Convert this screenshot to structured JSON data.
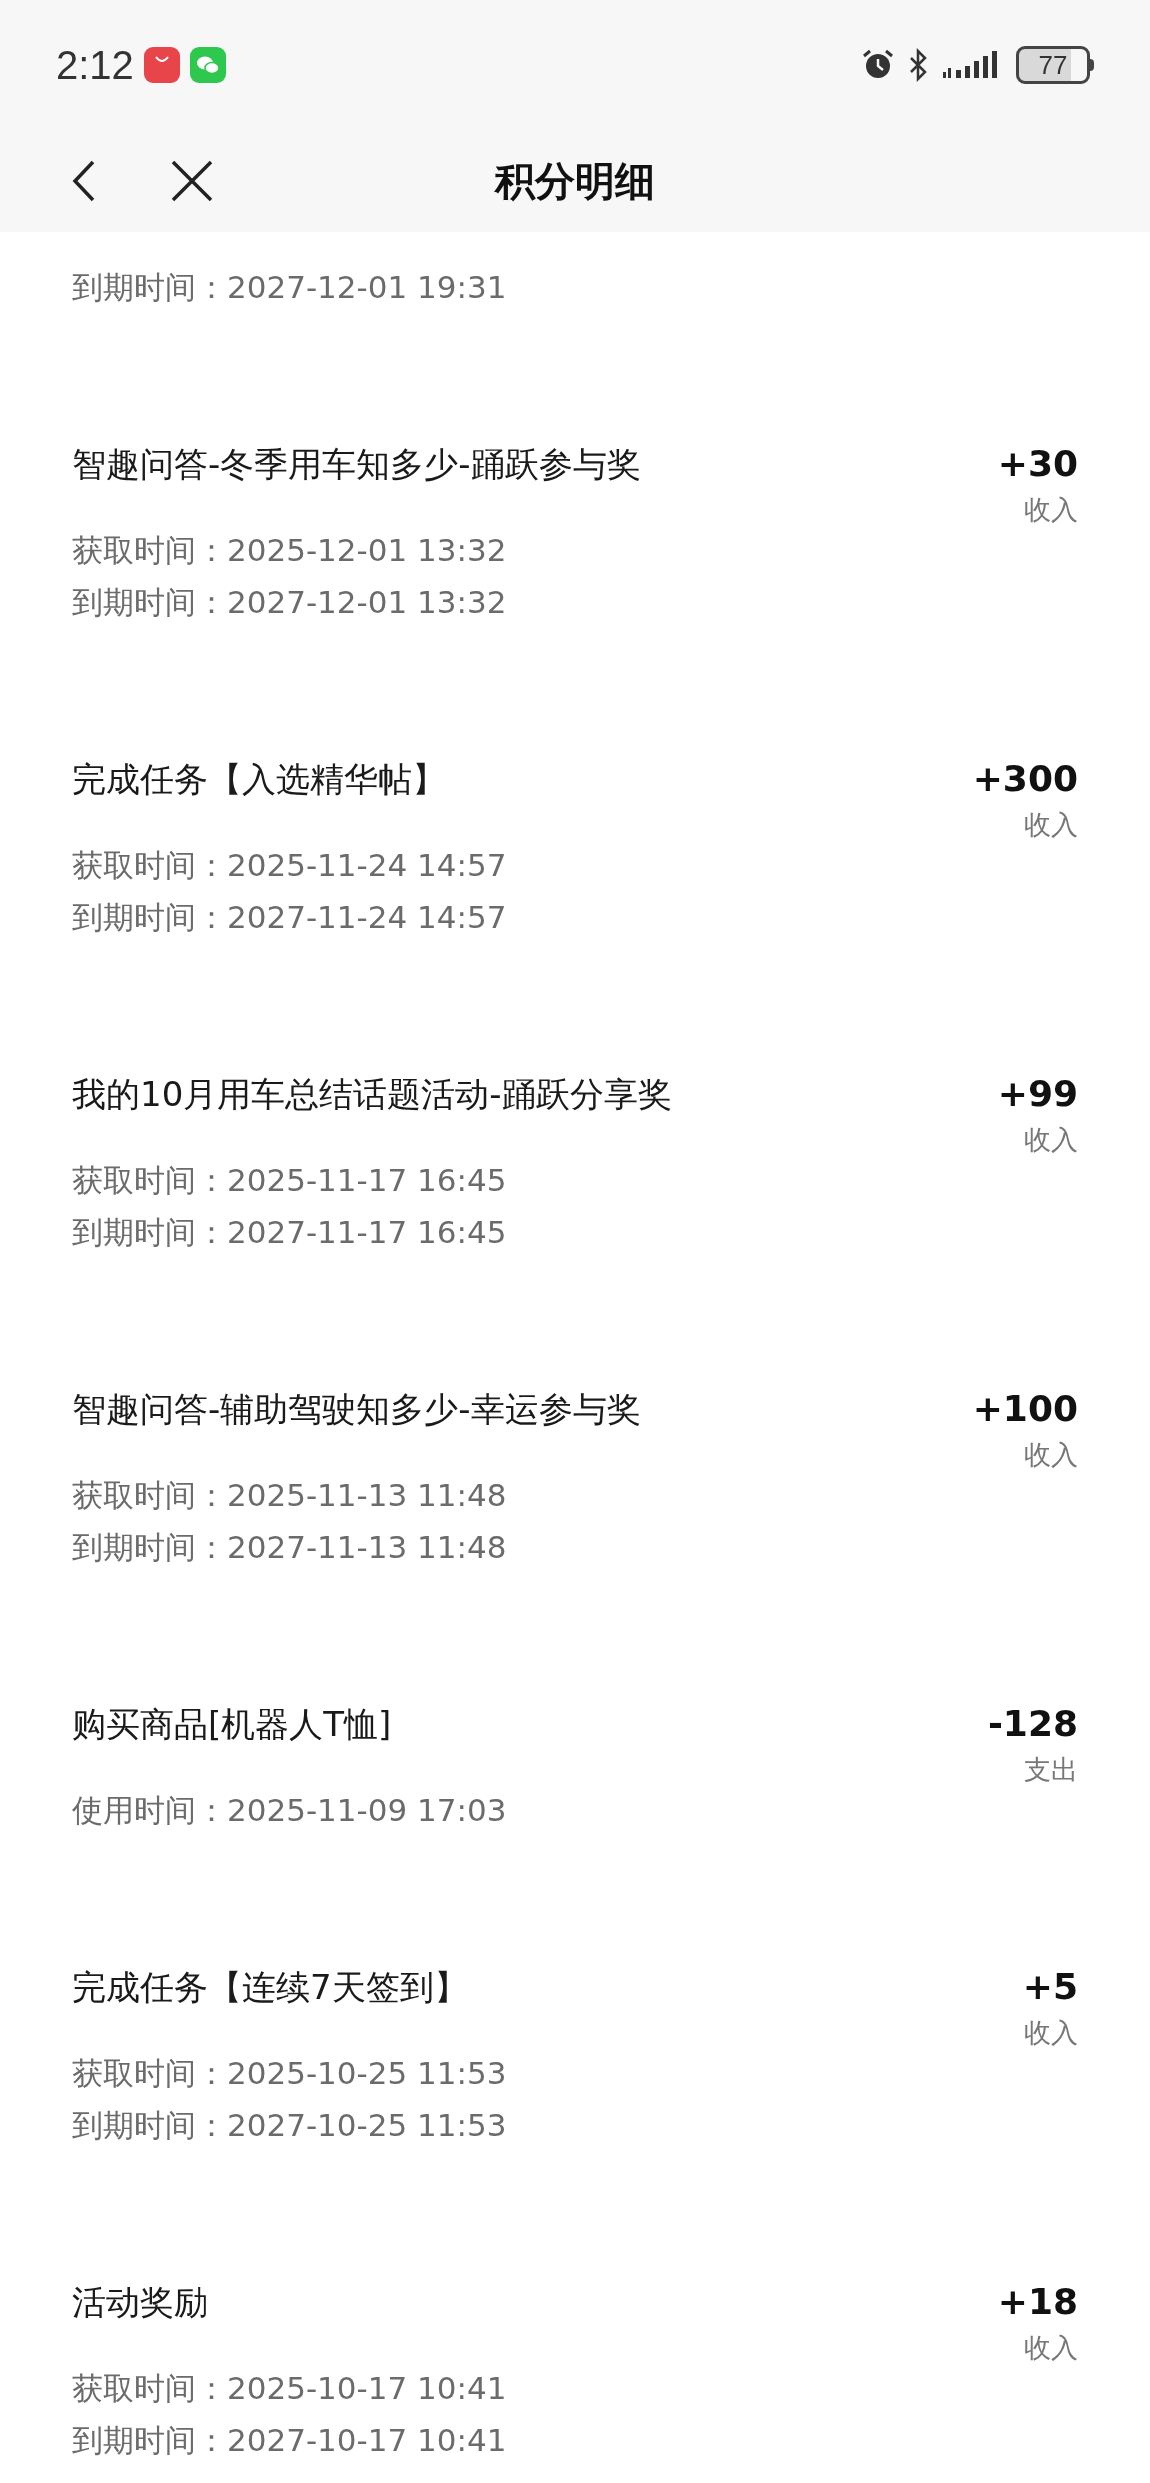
{
  "status_bar": {
    "time": "2:12",
    "battery": "77"
  },
  "header": {
    "title": "积分明细"
  },
  "partial_record": {
    "lines": [
      {
        "label": "到期时间：",
        "value": "2027-12-01 19:31"
      }
    ]
  },
  "records": [
    {
      "title": "智趣问答-冬季用车知多少-踊跃参与奖",
      "amount": "+30",
      "type": "收入",
      "lines": [
        {
          "label": "获取时间：",
          "value": "2025-12-01 13:32"
        },
        {
          "label": "到期时间：",
          "value": "2027-12-01 13:32"
        }
      ]
    },
    {
      "title": "完成任务【入选精华帖】",
      "amount": "+300",
      "type": "收入",
      "lines": [
        {
          "label": "获取时间：",
          "value": "2025-11-24 14:57"
        },
        {
          "label": "到期时间：",
          "value": "2027-11-24 14:57"
        }
      ]
    },
    {
      "title": "我的10月用车总结话题活动-踊跃分享奖",
      "amount": "+99",
      "type": "收入",
      "lines": [
        {
          "label": "获取时间：",
          "value": "2025-11-17 16:45"
        },
        {
          "label": "到期时间：",
          "value": "2027-11-17 16:45"
        }
      ]
    },
    {
      "title": "智趣问答-辅助驾驶知多少-幸运参与奖",
      "amount": "+100",
      "type": "收入",
      "lines": [
        {
          "label": "获取时间：",
          "value": "2025-11-13 11:48"
        },
        {
          "label": "到期时间：",
          "value": "2027-11-13 11:48"
        }
      ]
    },
    {
      "title": "购买商品[机器人T恤]",
      "amount": "-128",
      "type": "支出",
      "lines": [
        {
          "label": "使用时间：",
          "value": "2025-11-09 17:03"
        }
      ]
    },
    {
      "title": "完成任务【连续7天签到】",
      "amount": "+5",
      "type": "收入",
      "lines": [
        {
          "label": "获取时间：",
          "value": "2025-10-25 11:53"
        },
        {
          "label": "到期时间：",
          "value": "2027-10-25 11:53"
        }
      ]
    },
    {
      "title": "活动奖励",
      "amount": "+18",
      "type": "收入",
      "lines": [
        {
          "label": "获取时间：",
          "value": "2025-10-17 10:41"
        },
        {
          "label": "到期时间：",
          "value": "2027-10-17 10:41"
        }
      ]
    }
  ]
}
